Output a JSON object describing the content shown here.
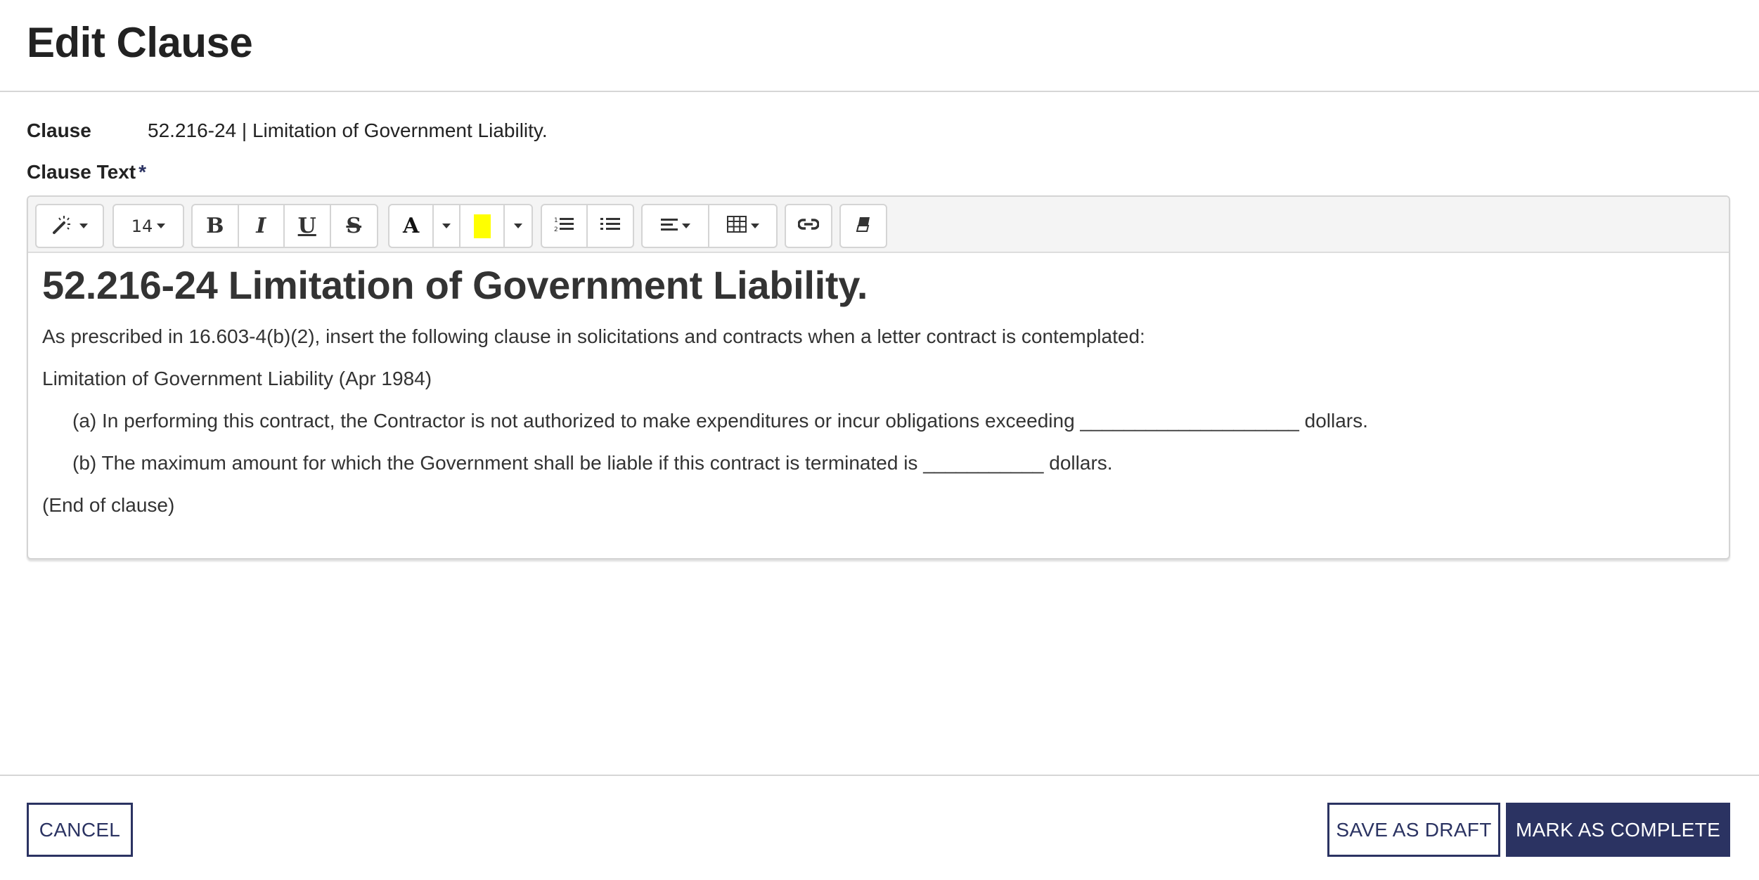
{
  "header": {
    "title": "Edit Clause"
  },
  "form": {
    "clause_label": "Clause",
    "clause_value": "52.216-24 | Limitation of Government Liability.",
    "clause_text_label": "Clause Text",
    "required_marker": "*"
  },
  "editor": {
    "toolbar": {
      "style_icon": "magic-wand-icon",
      "font_size": "14",
      "bold_label": "B",
      "italic_label": "I",
      "underline_label": "U",
      "strikethrough_label": "S",
      "font_color_label": "A",
      "highlight_color": "#ffff00",
      "ordered_list_icon": "ordered-list-icon",
      "unordered_list_icon": "unordered-list-icon",
      "align_icon": "align-left-icon",
      "table_icon": "table-icon",
      "link_icon": "link-icon",
      "eraser_icon": "eraser-icon"
    },
    "content": {
      "heading": "52.216-24 Limitation of Government Liability.",
      "paragraphs": [
        "As prescribed in 16.603-4(b)(2), insert the following clause in solicitations and contracts when a letter contract is contemplated:",
        "Limitation of Government Liability (Apr 1984)",
        "(a) In performing this contract, the Contractor is not authorized to make expenditures or incur obligations exceeding ____________________ dollars.",
        "(b) The maximum amount for which the Government shall be liable if this contract is terminated is ___________ dollars.",
        "(End of clause)"
      ]
    }
  },
  "footer": {
    "cancel_label": "CANCEL",
    "save_draft_label": "SAVE AS DRAFT",
    "mark_complete_label": "MARK AS COMPLETE"
  },
  "colors": {
    "primary": "#2b3362",
    "toolbar_bg": "#f4f4f4",
    "highlight": "#ffff00"
  }
}
